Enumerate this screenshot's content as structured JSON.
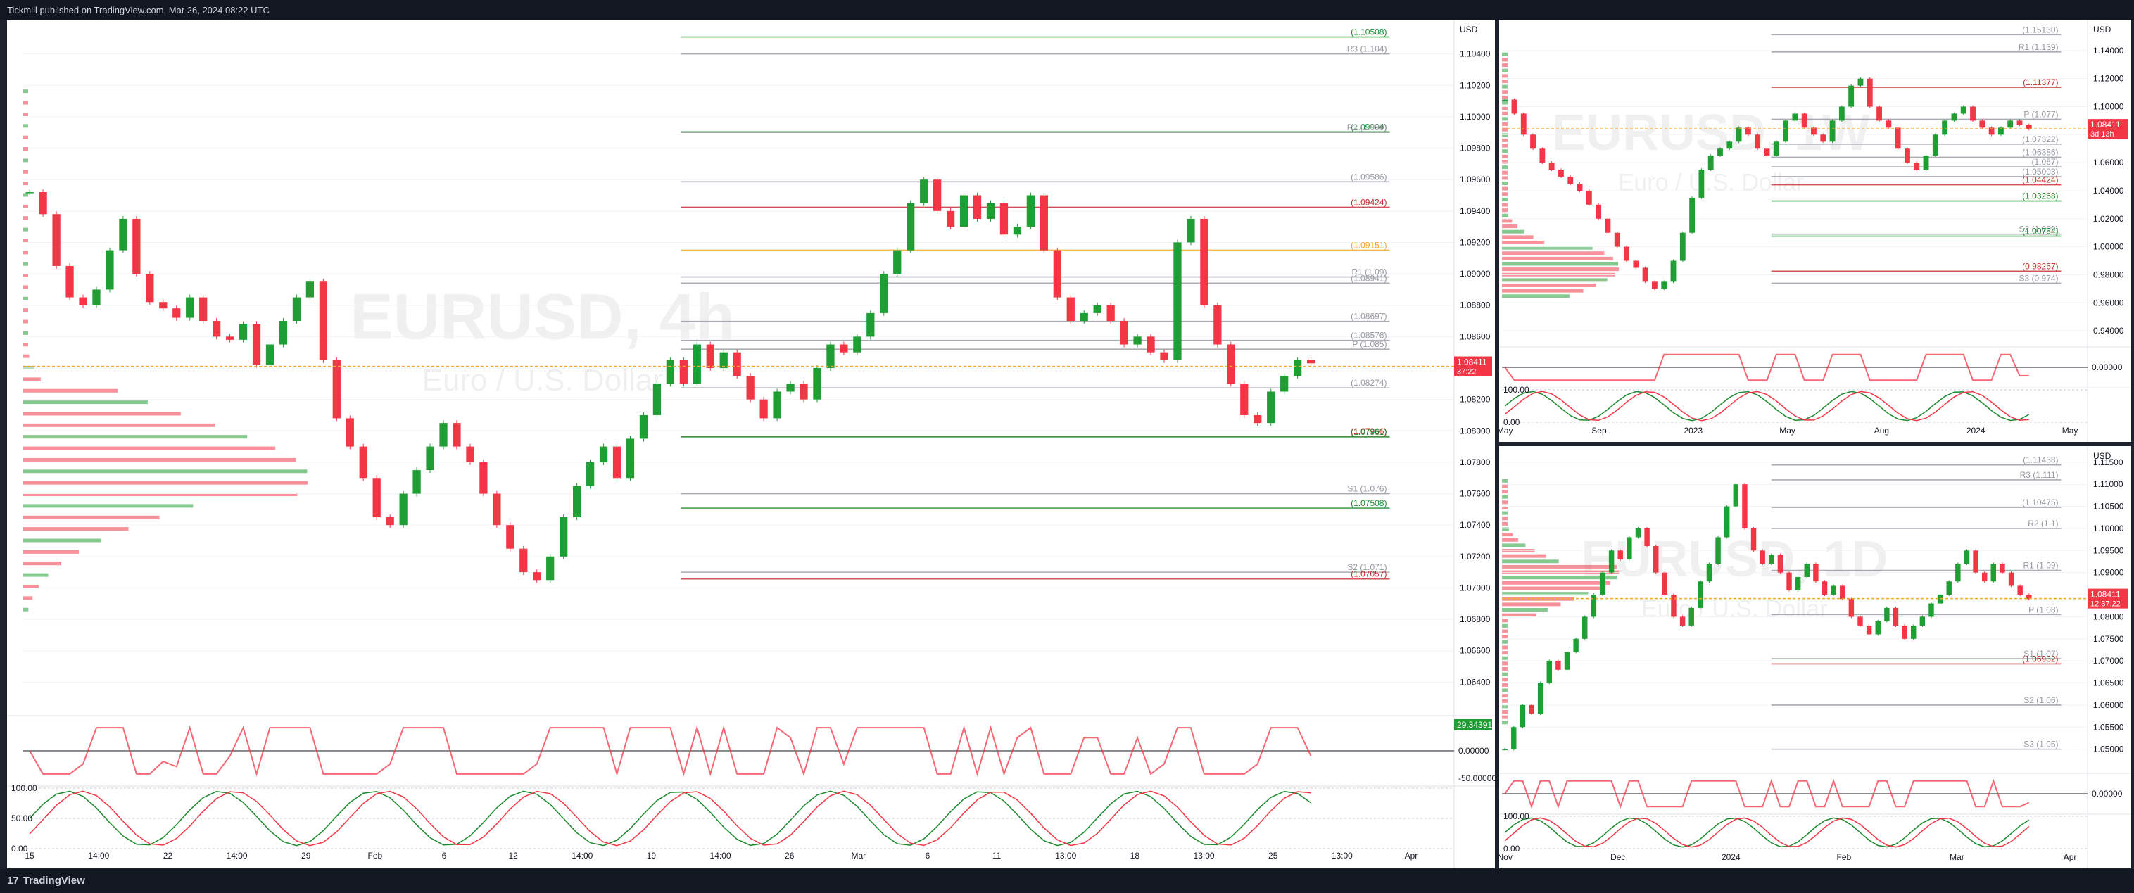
{
  "header": {
    "publisher": "Tickmill published on TradingView.com, Mar 26, 2024 08:22 UTC"
  },
  "footer": {
    "brand": "TradingView"
  },
  "colors": {
    "up": "#089981",
    "up_candle": "#1f9e33",
    "down": "#f23645",
    "level_green": "#1b8a2d",
    "level_red": "#c62828",
    "magenta": "#e040fb",
    "orange": "#f5a623",
    "grey": "#9598a1",
    "background": "#ffffff",
    "frame": "#1e222d"
  },
  "chart_data": [
    {
      "type": "line",
      "panel": "main",
      "watermark": "EURUSD, 4h",
      "watermark_sub": "Euro / U.S. Dollar",
      "currency": "USD",
      "ylim": [
        1.062,
        1.106
      ],
      "y_ticks": [
        1.104,
        1.102,
        1.1,
        1.098,
        1.096,
        1.094,
        1.092,
        1.09,
        1.088,
        1.086,
        1.084,
        1.082,
        1.08,
        1.078,
        1.076,
        1.074,
        1.072,
        1.07,
        1.068,
        1.066,
        1.064
      ],
      "y_tick_labels": [
        "1.10400",
        "1.10200",
        "1.10000",
        "1.09800",
        "1.09600",
        "1.09400",
        "1.09200",
        "1.09000",
        "1.08800",
        "1.08600",
        "1.08400",
        "1.08200",
        "1.08000",
        "1.07800",
        "1.07600",
        "1.07400",
        "1.07200",
        "1.07000",
        "1.06800",
        "1.06600",
        "1.06400"
      ],
      "x_labels": [
        "15",
        "14:00",
        "22",
        "14:00",
        "29",
        "Feb",
        "6",
        "12",
        "14:00",
        "19",
        "14:00",
        "26",
        "Mar",
        "6",
        "11",
        "13:00",
        "18",
        "13:00",
        "25",
        "13:00",
        "Apr"
      ],
      "close_series": [
        1.0952,
        1.0938,
        1.0905,
        1.0885,
        1.088,
        1.089,
        1.0915,
        1.0935,
        1.09,
        1.0882,
        1.0878,
        1.0872,
        1.0885,
        1.087,
        1.086,
        1.0858,
        1.0868,
        1.0842,
        1.0855,
        1.087,
        1.0885,
        1.0895,
        1.0845,
        1.0808,
        1.079,
        1.077,
        1.0745,
        1.074,
        1.076,
        1.0775,
        1.079,
        1.0805,
        1.079,
        1.078,
        1.076,
        1.074,
        1.0725,
        1.071,
        1.0705,
        1.072,
        1.0745,
        1.0765,
        1.078,
        1.079,
        1.077,
        1.0795,
        1.081,
        1.083,
        1.0845,
        1.083,
        1.0855,
        1.084,
        1.085,
        1.0835,
        1.082,
        1.0808,
        1.0825,
        1.083,
        1.082,
        1.084,
        1.0855,
        1.085,
        1.086,
        1.0875,
        1.09,
        1.0915,
        1.0945,
        1.096,
        1.094,
        1.093,
        1.095,
        1.0935,
        1.0945,
        1.0925,
        1.093,
        1.095,
        1.0915,
        1.0885,
        1.087,
        1.0875,
        1.088,
        1.087,
        1.0855,
        1.086,
        1.085,
        1.0845,
        1.092,
        1.0935,
        1.088,
        1.0855,
        1.083,
        1.081,
        1.0805,
        1.0825,
        1.0835,
        1.0845,
        1.0843
      ],
      "last_price": "1.08411",
      "last_price_countdown": "37:22",
      "levels": [
        {
          "label": "(1.10508)",
          "value": 1.10508,
          "color": "#1b8a2d"
        },
        {
          "label": "R3 (1.104)",
          "value": 1.104,
          "color": "#9598a1"
        },
        {
          "label": "(1.09904)",
          "value": 1.09904,
          "color": "#1b8a2d"
        },
        {
          "label": "R2 (1.099)",
          "value": 1.099,
          "color": "#9598a1"
        },
        {
          "label": "(1.09424)",
          "value": 1.09424,
          "color": "#c62828"
        },
        {
          "label": "(1.09586)",
          "value": 1.09586,
          "color": "#9598a1"
        },
        {
          "label": "(1.09151)",
          "value": 1.09151,
          "color": "#f5a623"
        },
        {
          "label": "R1 (1.09)",
          "value": 1.0898,
          "color": "#9598a1"
        },
        {
          "label": "(1.08941)",
          "value": 1.08941,
          "color": "#9598a1"
        },
        {
          "label": "(1.08697)",
          "value": 1.08697,
          "color": "#9598a1"
        },
        {
          "label": "(1.08576)",
          "value": 1.08576,
          "color": "#9598a1"
        },
        {
          "label": "P (1.085)",
          "value": 1.0852,
          "color": "#9598a1"
        },
        {
          "label": "(1.08274)",
          "value": 1.08274,
          "color": "#9598a1"
        },
        {
          "label": "(1.07966)",
          "value": 1.07966,
          "color": "#c62828"
        },
        {
          "label": "(1.07961)",
          "value": 1.07961,
          "color": "#1b8a2d"
        },
        {
          "label": "S1 (1.076)",
          "value": 1.076,
          "color": "#9598a1"
        },
        {
          "label": "(1.07508)",
          "value": 1.07508,
          "color": "#1b8a2d"
        },
        {
          "label": "S2 (1.071)",
          "value": 1.071,
          "color": "#9598a1"
        },
        {
          "label": "(1.07057)",
          "value": 1.07057,
          "color": "#c62828"
        }
      ],
      "indicators": [
        {
          "name": "cci",
          "labels": [
            "0.00000",
            "-50.00000"
          ],
          "value_label": "29.34391"
        },
        {
          "name": "stochastic",
          "labels": [
            "100.00",
            "50.00",
            "0.00"
          ]
        }
      ]
    },
    {
      "type": "line",
      "panel": "weekly",
      "watermark": "EURUSD, 1W",
      "watermark_sub": "Euro / U.S. Dollar",
      "currency": "USD",
      "ylim": [
        0.93,
        1.16
      ],
      "y_ticks": [
        1.14,
        1.12,
        1.1,
        1.08,
        1.06,
        1.04,
        1.02,
        1.0,
        0.98,
        0.96,
        0.94
      ],
      "y_tick_labels": [
        "1.14000",
        "1.12000",
        "1.10000",
        "1.08000",
        "1.06000",
        "1.04000",
        "1.02000",
        "1.00000",
        "0.98000",
        "0.96000",
        "0.94000"
      ],
      "x_labels": [
        "May",
        "Sep",
        "2023",
        "May",
        "Aug",
        "2024",
        "May"
      ],
      "close_series": [
        1.105,
        1.095,
        1.08,
        1.07,
        1.06,
        1.055,
        1.05,
        1.045,
        1.04,
        1.03,
        1.02,
        1.01,
        1.0,
        0.99,
        0.985,
        0.975,
        0.97,
        0.975,
        0.99,
        1.01,
        1.035,
        1.055,
        1.065,
        1.07,
        1.075,
        1.085,
        1.08,
        1.07,
        1.065,
        1.075,
        1.09,
        1.095,
        1.085,
        1.08,
        1.075,
        1.09,
        1.1,
        1.115,
        1.12,
        1.1,
        1.09,
        1.085,
        1.07,
        1.06,
        1.055,
        1.065,
        1.08,
        1.09,
        1.095,
        1.1,
        1.09,
        1.085,
        1.08,
        1.085,
        1.09,
        1.087,
        1.084
      ],
      "last_price": "1.08411",
      "last_price_countdown": "3d 13h",
      "levels": [
        {
          "label": "(1.15130)",
          "value": 1.1513,
          "color": "#9598a1"
        },
        {
          "label": "R1 (1.139)",
          "value": 1.139,
          "color": "#9598a1"
        },
        {
          "label": "(1.11377)",
          "value": 1.11377,
          "color": "#c62828"
        },
        {
          "label": "P (1.077)",
          "value": 1.091,
          "color": "#9598a1"
        },
        {
          "label": "(1.07322)",
          "value": 1.0732,
          "color": "#9598a1"
        },
        {
          "label": "(1.06386)",
          "value": 1.06386,
          "color": "#9598a1"
        },
        {
          "label": "(1.057)",
          "value": 1.057,
          "color": "#9598a1"
        },
        {
          "label": "(1.05003)",
          "value": 1.05003,
          "color": "#9598a1"
        },
        {
          "label": "(1.04424)",
          "value": 1.04424,
          "color": "#c62828"
        },
        {
          "label": "(1.03268)",
          "value": 1.03268,
          "color": "#1b8a2d"
        },
        {
          "label": "S2 (1.009)",
          "value": 1.009,
          "color": "#9598a1"
        },
        {
          "label": "(1.00754)",
          "value": 1.00754,
          "color": "#1b8a2d"
        },
        {
          "label": "(0.98257)",
          "value": 0.98257,
          "color": "#c62828"
        },
        {
          "label": "S3 (0.974)",
          "value": 0.974,
          "color": "#9598a1"
        }
      ],
      "indicators": [
        {
          "name": "cci",
          "labels": [
            "0.00000"
          ]
        },
        {
          "name": "stochastic",
          "labels": [
            "100.00",
            "0.00"
          ]
        }
      ]
    },
    {
      "type": "line",
      "panel": "daily",
      "watermark": "EURUSD, 1D",
      "watermark_sub": "Euro / U.S. Dollar",
      "currency": "USD",
      "ylim": [
        1.045,
        1.118
      ],
      "y_ticks": [
        1.115,
        1.11,
        1.105,
        1.1,
        1.095,
        1.09,
        1.085,
        1.08,
        1.075,
        1.07,
        1.065,
        1.06,
        1.055,
        1.05
      ],
      "y_tick_labels": [
        "1.11500",
        "1.11000",
        "1.10500",
        "1.10000",
        "1.09500",
        "1.09000",
        "1.08500",
        "1.08000",
        "1.07500",
        "1.07000",
        "1.06500",
        "1.06000",
        "1.05500",
        "1.05000"
      ],
      "x_labels": [
        "Nov",
        "Dec",
        "2024",
        "Feb",
        "Mar",
        "Apr"
      ],
      "close_series": [
        1.05,
        1.055,
        1.06,
        1.058,
        1.065,
        1.07,
        1.068,
        1.072,
        1.075,
        1.08,
        1.085,
        1.09,
        1.095,
        1.093,
        1.098,
        1.1,
        1.096,
        1.09,
        1.085,
        1.08,
        1.078,
        1.082,
        1.088,
        1.092,
        1.098,
        1.105,
        1.11,
        1.1,
        1.095,
        1.092,
        1.094,
        1.09,
        1.086,
        1.089,
        1.092,
        1.088,
        1.085,
        1.087,
        1.084,
        1.08,
        1.078,
        1.076,
        1.079,
        1.082,
        1.078,
        1.075,
        1.078,
        1.08,
        1.083,
        1.085,
        1.088,
        1.092,
        1.095,
        1.09,
        1.088,
        1.092,
        1.09,
        1.087,
        1.085,
        1.084
      ],
      "last_price": "1.08411",
      "last_price_countdown": "12:37:22",
      "levels": [
        {
          "label": "(1.11438)",
          "value": 1.11438,
          "color": "#9598a1"
        },
        {
          "label": "R3 (1.111)",
          "value": 1.111,
          "color": "#9598a1"
        },
        {
          "label": "(1.10475)",
          "value": 1.10475,
          "color": "#9598a1"
        },
        {
          "label": "R2 (1.1)",
          "value": 1.1,
          "color": "#9598a1"
        },
        {
          "label": "R1 (1.09)",
          "value": 1.0905,
          "color": "#9598a1"
        },
        {
          "label": "P (1.08)",
          "value": 1.0805,
          "color": "#9598a1"
        },
        {
          "label": "S1 (1.07)",
          "value": 1.0705,
          "color": "#9598a1"
        },
        {
          "label": "(1.06932)",
          "value": 1.06932,
          "color": "#c62828"
        },
        {
          "label": "S2 (1.06)",
          "value": 1.06,
          "color": "#9598a1"
        },
        {
          "label": "S3 (1.05)",
          "value": 1.05,
          "color": "#9598a1"
        }
      ],
      "indicators": [
        {
          "name": "cci",
          "labels": [
            "0.00000"
          ]
        },
        {
          "name": "stochastic",
          "labels": [
            "100.00",
            "0.00"
          ]
        }
      ]
    }
  ]
}
